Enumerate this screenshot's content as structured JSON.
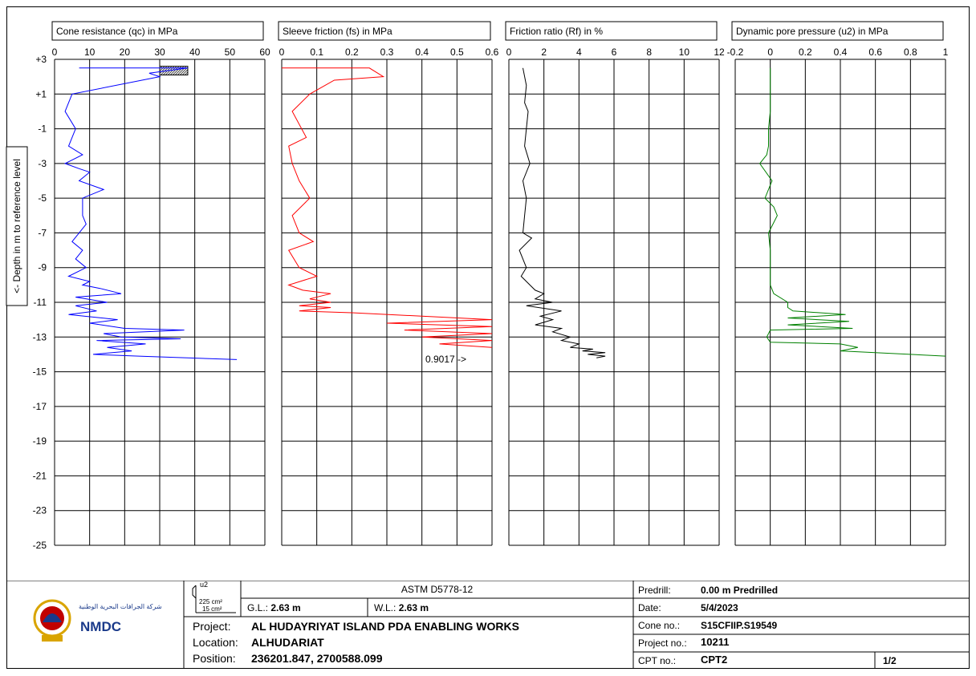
{
  "panels": [
    {
      "title": "Cone resistance (qc) in MPa",
      "ticks": [
        "0",
        "10",
        "20",
        "30",
        "40",
        "50",
        "60"
      ],
      "xlim": [
        0,
        60
      ],
      "color": "#0000ff"
    },
    {
      "title": "Sleeve friction (fs) in MPa",
      "ticks": [
        "0",
        "0.1",
        "0.2",
        "0.3",
        "0.4",
        "0.5",
        "0.6"
      ],
      "xlim": [
        0,
        0.6
      ],
      "color": "#ff0000"
    },
    {
      "title": "Friction ratio (Rf) in %",
      "ticks": [
        "0",
        "2",
        "4",
        "6",
        "8",
        "10",
        "12"
      ],
      "xlim": [
        0,
        12
      ],
      "color": "#000000"
    },
    {
      "title": "Dynamic pore pressure (u2) in MPa",
      "ticks": [
        "-0.2",
        "0",
        "0.2",
        "0.4",
        "0.6",
        "0.8",
        "1"
      ],
      "xlim": [
        -0.2,
        1
      ],
      "color": "#008000"
    }
  ],
  "depth_axis": {
    "label": "<- Depth in m to reference level",
    "ticks": [
      "+3",
      "+1",
      "-1",
      "-3",
      "-5",
      "-7",
      "-9",
      "-11",
      "-13",
      "-15",
      "-17",
      "-19",
      "-21",
      "-23",
      "-25"
    ],
    "ylim": [
      3,
      -25
    ]
  },
  "annotation": "0.9017 ->",
  "chart_data": [
    {
      "type": "line",
      "title": "Cone resistance (qc) in MPa",
      "ylabel": "<- Depth in m to reference level",
      "xlim": [
        0,
        60
      ],
      "ylim": [
        3,
        -25
      ],
      "x": [
        7,
        38,
        27,
        30,
        5,
        3,
        6,
        4,
        8,
        3,
        7,
        10,
        7,
        14,
        8,
        8,
        9,
        7,
        5,
        8,
        6,
        9,
        4,
        10,
        8,
        13,
        19,
        6,
        15,
        6,
        12,
        4,
        18,
        10,
        20,
        37,
        14,
        19,
        36,
        12,
        26,
        15,
        22,
        11,
        24,
        52
      ],
      "y": [
        2.5,
        2.5,
        2.2,
        2.0,
        1.0,
        0.0,
        -1.0,
        -2.0,
        -2.5,
        -3.0,
        -3.3,
        -3.5,
        -4.0,
        -4.5,
        -5.0,
        -6.0,
        -6.5,
        -7.0,
        -7.5,
        -8.0,
        -8.5,
        -9.0,
        -9.5,
        -9.8,
        -10.0,
        -10.2,
        -10.5,
        -10.7,
        -11.0,
        -11.2,
        -11.5,
        -11.7,
        -12.0,
        -12.2,
        -12.5,
        -12.6,
        -12.8,
        -13.0,
        -13.1,
        -13.2,
        -13.4,
        -13.6,
        -13.8,
        -14.0,
        -14.1,
        -14.3
      ]
    },
    {
      "type": "line",
      "title": "Sleeve friction (fs) in MPa",
      "xlim": [
        0,
        0.6
      ],
      "ylim": [
        3,
        -25
      ],
      "x": [
        0.0,
        0.25,
        0.29,
        0.15,
        0.08,
        0.03,
        0.07,
        0.02,
        0.03,
        0.05,
        0.08,
        0.03,
        0.05,
        0.09,
        0.02,
        0.05,
        0.1,
        0.02,
        0.06,
        0.14,
        0.08,
        0.14,
        0.05,
        0.14,
        0.05,
        0.2,
        0.6,
        0.3,
        0.6,
        0.35,
        0.6,
        0.4,
        0.6,
        0.45,
        0.6
      ],
      "y": [
        2.5,
        2.5,
        2.0,
        1.8,
        1.0,
        0.0,
        -1.5,
        -2.0,
        -3.0,
        -4.0,
        -5.0,
        -6.0,
        -7.0,
        -7.5,
        -8.0,
        -9.0,
        -9.5,
        -10.0,
        -10.3,
        -10.5,
        -10.8,
        -11.0,
        -11.2,
        -11.3,
        -11.5,
        -11.6,
        -12.0,
        -12.2,
        -12.4,
        -12.6,
        -12.8,
        -13.0,
        -13.2,
        -13.4,
        -13.6
      ]
    },
    {
      "type": "line",
      "title": "Friction ratio (Rf) in %",
      "xlim": [
        0,
        12
      ],
      "ylim": [
        3,
        -25
      ],
      "x": [
        0.8,
        1.0,
        0.9,
        1.1,
        1.0,
        0.9,
        1.2,
        0.8,
        1.0,
        0.9,
        0.8,
        1.3,
        0.6,
        1.0,
        0.7,
        1.2,
        1.5,
        2.0,
        1.5,
        2.5,
        1.0,
        3.0,
        1.8,
        2.5,
        1.5,
        3.0,
        2.5,
        3.5,
        3.0,
        4.0,
        3.5,
        4.8,
        4.2,
        5.5,
        4.5,
        5.5,
        5.0
      ],
      "y": [
        2.5,
        1.5,
        0.5,
        0.0,
        -1.0,
        -2.0,
        -3.0,
        -4.0,
        -5.0,
        -6.0,
        -7.0,
        -7.3,
        -8.0,
        -9.0,
        -9.5,
        -10.0,
        -10.3,
        -10.5,
        -10.8,
        -11.0,
        -11.2,
        -11.5,
        -11.8,
        -12.0,
        -12.3,
        -12.5,
        -12.7,
        -13.0,
        -13.2,
        -13.4,
        -13.6,
        -13.7,
        -13.8,
        -13.9,
        -14.0,
        -14.1,
        -14.2
      ]
    },
    {
      "type": "line",
      "title": "Dynamic pore pressure (u2) in MPa",
      "xlim": [
        -0.2,
        1
      ],
      "ylim": [
        3,
        -25
      ],
      "x": [
        0.0,
        0.0,
        -0.01,
        -0.01,
        -0.02,
        -0.06,
        0.01,
        -0.03,
        0.02,
        0.04,
        -0.01,
        0.0,
        0.0,
        0.0,
        0.02,
        0.1,
        0.1,
        0.13,
        0.43,
        0.1,
        0.45,
        0.1,
        0.47,
        0.0,
        -0.02,
        0.0,
        0.4,
        0.5,
        0.4,
        1.0
      ],
      "y": [
        2.5,
        0.0,
        -1.0,
        -2.0,
        -2.5,
        -3.0,
        -4.0,
        -5.0,
        -5.5,
        -6.0,
        -7.0,
        -8.0,
        -9.0,
        -10.0,
        -10.5,
        -11.0,
        -11.3,
        -11.5,
        -11.7,
        -11.9,
        -12.1,
        -12.3,
        -12.5,
        -12.6,
        -13.0,
        -13.3,
        -13.4,
        -13.6,
        -13.8,
        -14.1
      ]
    }
  ],
  "footer": {
    "standard": "ASTM D5778-12",
    "cone_u2": "u2",
    "cone_area1": "225",
    "cone_area2": "15",
    "cone_unit": "cm²",
    "gl_label": "G.L.:",
    "gl_value": "2.63 m",
    "wl_label": "W.L.:",
    "wl_value": "2.63 m",
    "project_label": "Project:",
    "project_value": "AL HUDAYRIYAT ISLAND PDA ENABLING WORKS",
    "location_label": "Location:",
    "location_value": "ALHUDARIAT",
    "position_label": "Position:",
    "position_value": "236201.847, 2700588.099",
    "predrill_label": "Predrill:",
    "predrill_value": "0.00 m Predrilled",
    "date_label": "Date:",
    "date_value": "5/4/2023",
    "cone_no_label": "Cone no.:",
    "cone_no_value": "S15CFIIP.S19549",
    "project_no_label": "Project no.:",
    "project_no_value": "10211",
    "cpt_no_label": "CPT no.:",
    "cpt_no_value": "CPT2",
    "page": "1/2",
    "logo_text": "NMDC",
    "logo_arabic": "شركة الجرافات البحرية الوطنية"
  }
}
